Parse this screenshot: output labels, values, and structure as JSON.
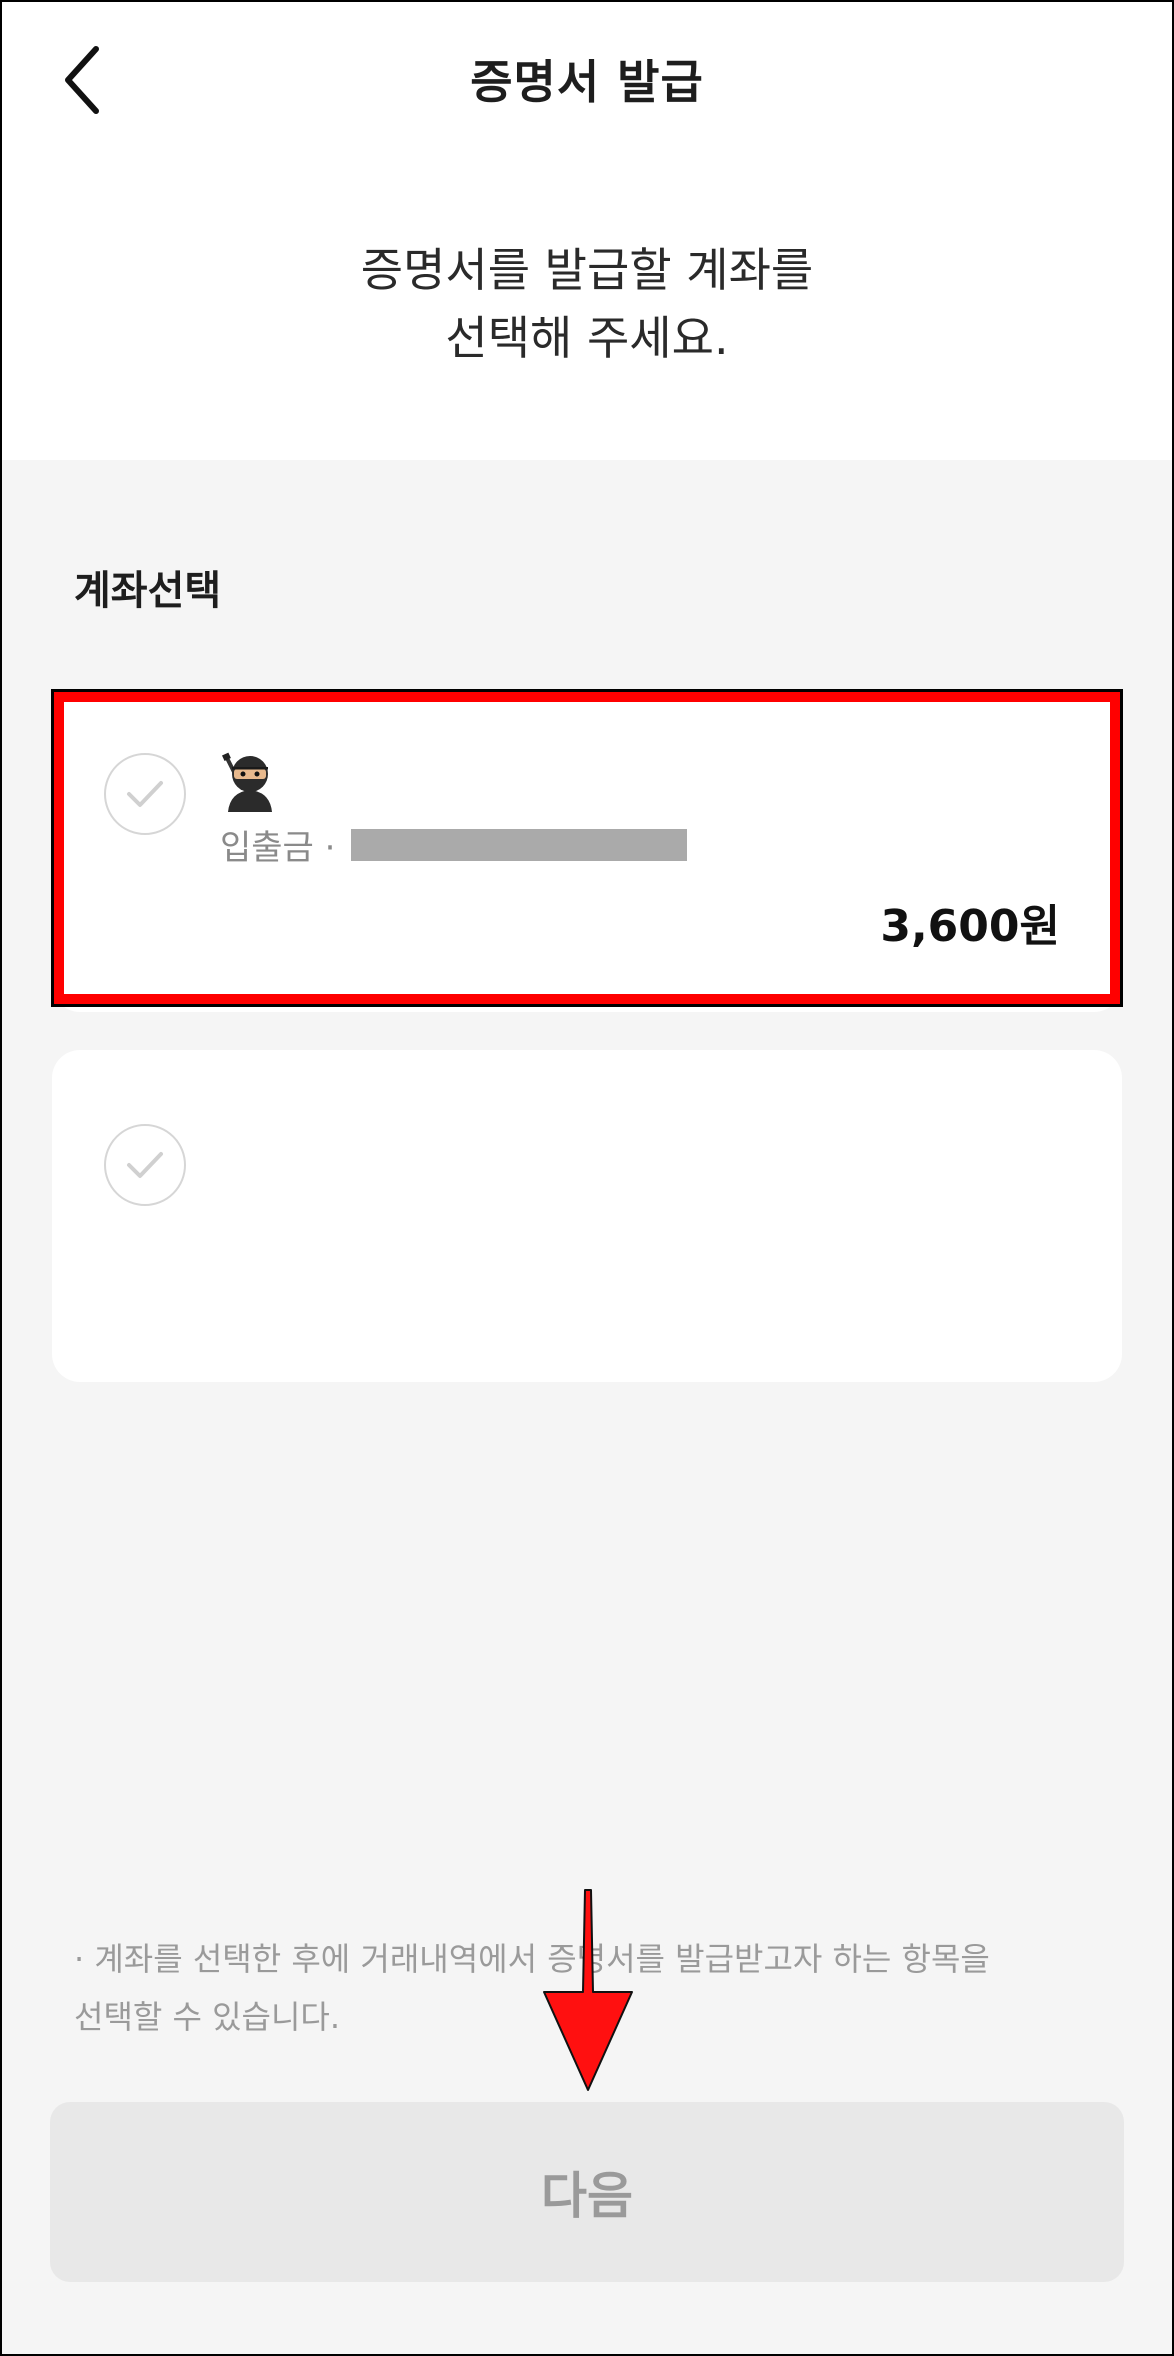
{
  "header": {
    "back_icon": "chevron-left-icon",
    "title": "증명서 발급"
  },
  "intro": {
    "line1": "증명서를 발급할 계좌를",
    "line2": "선택해 주세요."
  },
  "section": {
    "label": "계좌선택"
  },
  "accounts": [
    {
      "selected": false,
      "emoji": "ninja-emoji-icon",
      "type_label": "입출금 ·",
      "account_number_redacted": true,
      "balance": "3,600원"
    },
    {
      "selected": false
    }
  ],
  "notice": {
    "line1": "· 계좌를 선택한 후에 거래내역에서 증명서를 발급받고자 하는 항목을",
    "line2": "선택할 수 있습니다."
  },
  "footer": {
    "next_label": "다음"
  },
  "colors": {
    "annotation_red": "#ff0000",
    "page_bg": "#f5f5f5",
    "button_bg": "#e8e8e8",
    "button_text": "#9a9a9a"
  }
}
